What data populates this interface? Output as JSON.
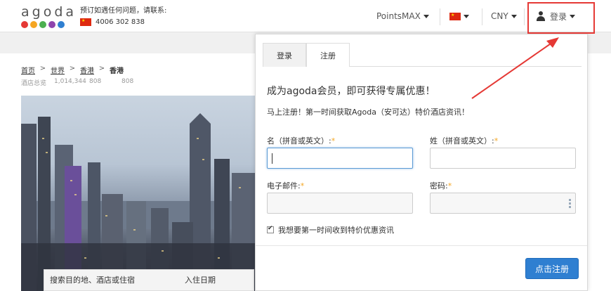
{
  "brand": {
    "logo_text": "agoda",
    "dot_colors": [
      "#e53935",
      "#f5a623",
      "#4caf50",
      "#8e44ad",
      "#2f7fd1"
    ]
  },
  "help": {
    "text": "预订如遇任何问题，请联系:",
    "phone": "4006 302 838"
  },
  "nav": {
    "points": "PointsMAX",
    "currency": "CNY",
    "login": "登录"
  },
  "breadcrumb": {
    "items": [
      {
        "label": "首页",
        "count_label": "酒店总览"
      },
      {
        "label": "世界",
        "count_label": "1,014,344"
      },
      {
        "label": "香港",
        "count_label": "808"
      },
      {
        "label": "香港",
        "count_label": "808"
      }
    ],
    "arrow": ">"
  },
  "search": {
    "destination_label": "搜索目的地、酒店或住宿",
    "checkin_label": "入住日期"
  },
  "modal": {
    "tabs": [
      "登录",
      "注册"
    ],
    "heading": "成为agoda会员，即可获得专属优惠！",
    "subheading": "马上注册！第一时间获取Agoda（安可达）特价酒店资讯！",
    "first_name_label": "名（拼音或英文）:",
    "last_name_label": "姓（拼音或英文）:",
    "email_label": "电子邮件:",
    "password_label": "密码:",
    "required_mark": "*",
    "newsletter_label": "我想要第一时间收到特价优惠资讯",
    "newsletter_checked": true,
    "submit_label": "点击注册"
  },
  "colors": {
    "accent": "#2f7fd1",
    "highlight": "#e53935",
    "required": "#f5a623"
  }
}
